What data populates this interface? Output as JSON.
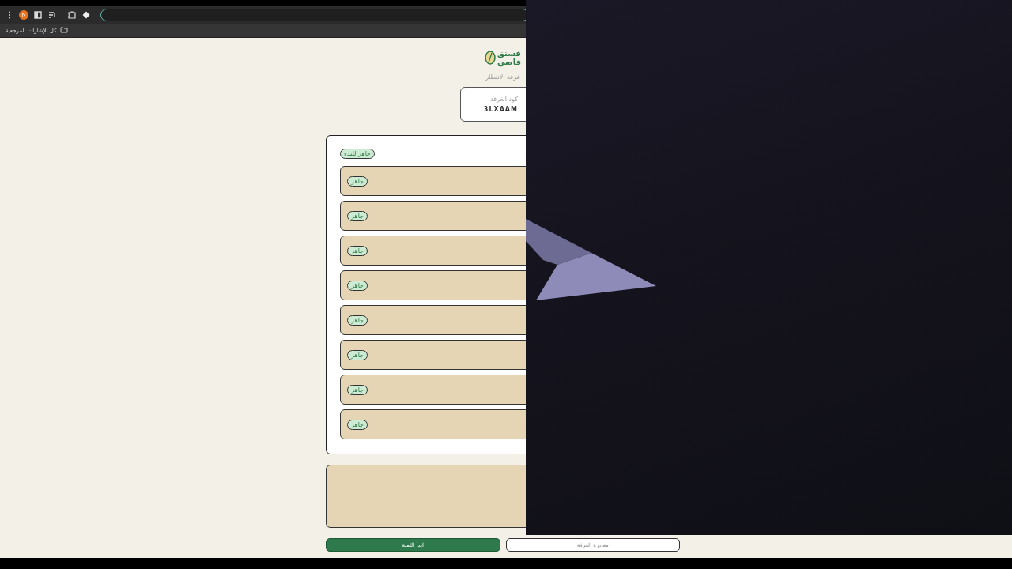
{
  "browser": {
    "profile_initial": "N",
    "bookmarks": [
      {
        "label": "كل الإشارات المرجعية"
      }
    ]
  },
  "logo": {
    "lines": [
      "فستق",
      "فاضي"
    ]
  },
  "page_title": "غرفة الانتظار",
  "room_code": {
    "label": "كود الغرفة",
    "value": "3LXAAM"
  },
  "players_card": {
    "status_badge": "جاهز للبدء",
    "players": [
      {
        "status": "جاهز"
      },
      {
        "status": "جاهز"
      },
      {
        "status": "جاهز"
      },
      {
        "status": "جاهز"
      },
      {
        "status": "جاهز"
      },
      {
        "status": "جاهز"
      },
      {
        "status": "جاهز"
      },
      {
        "status": "جاهز"
      }
    ]
  },
  "buttons": [
    {
      "label": "مغادرة الغرفة",
      "kind": "secondary"
    },
    {
      "label": "ابدأ اللعبة",
      "kind": "primary"
    }
  ]
}
